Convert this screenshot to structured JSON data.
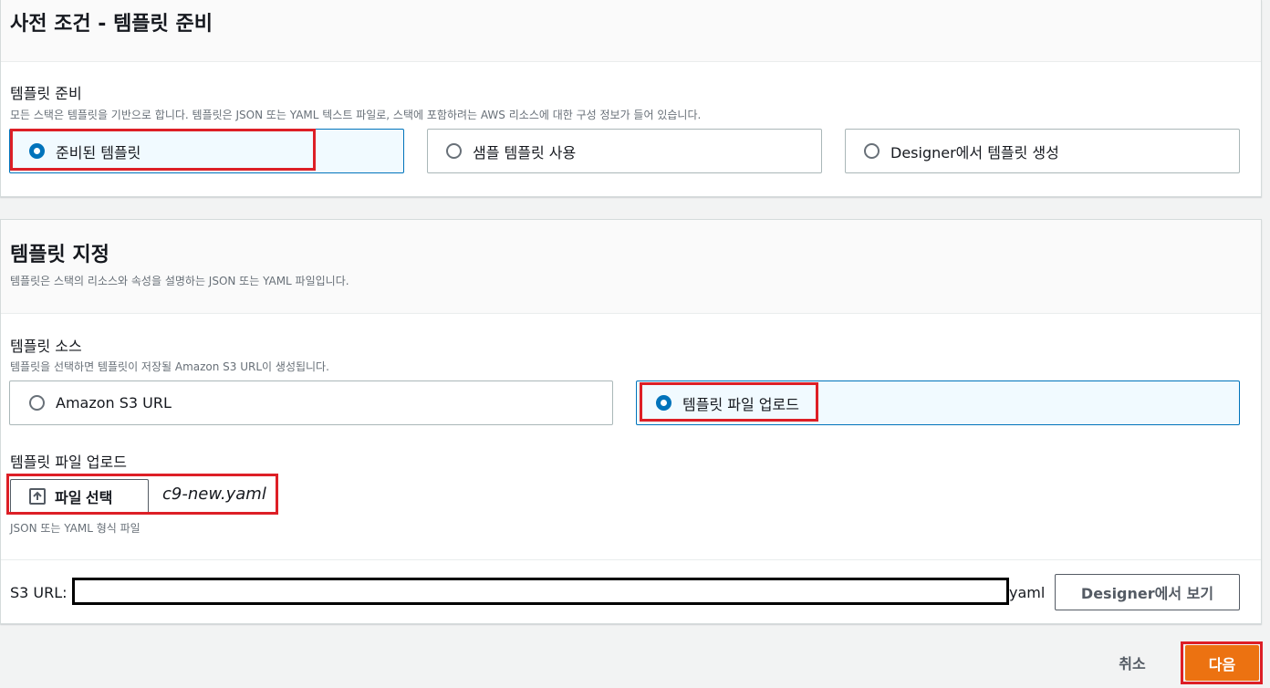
{
  "prerequisite": {
    "title": "사전 조건 - 템플릿 준비",
    "field_label": "템플릿 준비",
    "field_desc": "모든 스택은 템플릿을 기반으로 합니다. 템플릿은 JSON 또는 YAML 텍스트 파일로, 스택에 포함하려는 AWS 리소스에 대한 구성 정보가 들어 있습니다.",
    "options": [
      {
        "label": "준비된 템플릿",
        "selected": true
      },
      {
        "label": "샘플 템플릿 사용",
        "selected": false
      },
      {
        "label": "Designer에서 템플릿 생성",
        "selected": false
      }
    ]
  },
  "specify": {
    "title": "템플릿 지정",
    "desc": "템플릿은 스택의 리소스와 속성을 설명하는 JSON 또는 YAML 파일입니다.",
    "source_label": "템플릿 소스",
    "source_desc": "템플릿을 선택하면 템플릿이 저장될 Amazon S3 URL이 생성됩니다.",
    "source_options": [
      {
        "label": "Amazon S3 URL",
        "selected": false
      },
      {
        "label": "템플릿 파일 업로드",
        "selected": true
      }
    ],
    "upload_label": "템플릿 파일 업로드",
    "choose_file_label": "파일 선택",
    "file_name": "c9-new.yaml",
    "upload_hint": "JSON 또는 YAML 형식 파일",
    "s3_label": "S3 URL:",
    "s3_value": "",
    "s3_suffix": "yaml",
    "designer_button": "Designer에서 보기"
  },
  "footer": {
    "cancel": "취소",
    "next": "다음"
  },
  "colors": {
    "accent": "#0073bb",
    "primary_button": "#ec7211",
    "annotation_red": "#dd1f26"
  }
}
